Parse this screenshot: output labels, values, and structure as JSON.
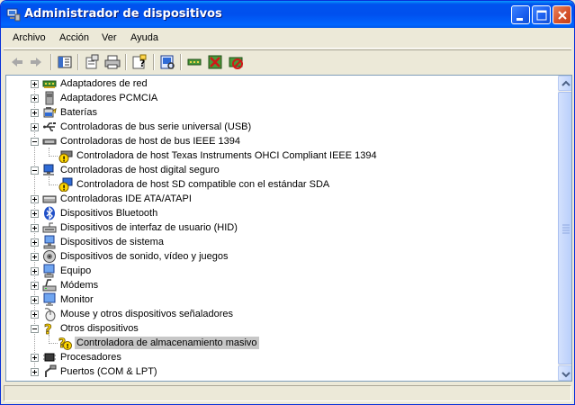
{
  "window": {
    "title": "Administrador de dispositivos",
    "app_icon": "device-manager-icon",
    "controls": [
      "minimize-icon",
      "maximize-icon",
      "close-icon"
    ]
  },
  "menu": {
    "items": [
      {
        "label": "Archivo"
      },
      {
        "label": "Acción"
      },
      {
        "label": "Ver"
      },
      {
        "label": "Ayuda"
      }
    ]
  },
  "toolbar": {
    "buttons": [
      {
        "icon": "back-arrow-icon"
      },
      {
        "icon": "forward-arrow-icon"
      },
      {
        "icon": "console-tree-icon"
      },
      {
        "icon": "properties-icon"
      },
      {
        "icon": "print-icon"
      },
      {
        "icon": "help-icon"
      },
      {
        "icon": "scan-hardware-icon"
      },
      {
        "icon": "update-driver-icon"
      },
      {
        "icon": "uninstall-icon"
      },
      {
        "icon": "disable-device-icon"
      }
    ]
  },
  "tree": {
    "items": [
      {
        "label": "Adaptadores de red",
        "icon": "network-adapter-icon",
        "level": 0,
        "expanded": false
      },
      {
        "label": "Adaptadores PCMCIA",
        "icon": "pcmcia-icon",
        "level": 0,
        "expanded": false
      },
      {
        "label": "Baterías",
        "icon": "battery-icon",
        "level": 0,
        "expanded": false
      },
      {
        "label": "Controladoras de bus serie universal (USB)",
        "icon": "usb-icon",
        "level": 0,
        "expanded": false
      },
      {
        "label": "Controladoras de host de bus IEEE 1394",
        "icon": "ieee1394-icon",
        "level": 0,
        "expanded": true
      },
      {
        "label": "Controladora de host Texas Instruments OHCI Compliant IEEE 1394",
        "icon": "warning-device-icon",
        "level": 1
      },
      {
        "label": "Controladoras de host digital seguro",
        "icon": "sd-host-icon",
        "level": 0,
        "expanded": true
      },
      {
        "label": "Controladora de host SD compatible con el estándar SDA",
        "icon": "warning-device-icon",
        "level": 1
      },
      {
        "label": "Controladoras IDE ATA/ATAPI",
        "icon": "ide-controller-icon",
        "level": 0,
        "expanded": false
      },
      {
        "label": "Dispositivos Bluetooth",
        "icon": "bluetooth-icon",
        "level": 0,
        "expanded": false
      },
      {
        "label": "Dispositivos de interfaz de usuario (HID)",
        "icon": "hid-icon",
        "level": 0,
        "expanded": false
      },
      {
        "label": "Dispositivos de sistema",
        "icon": "system-device-icon",
        "level": 0,
        "expanded": false
      },
      {
        "label": "Dispositivos de sonido, vídeo y juegos",
        "icon": "sound-icon",
        "level": 0,
        "expanded": false
      },
      {
        "label": "Equipo",
        "icon": "computer-icon",
        "level": 0,
        "expanded": false
      },
      {
        "label": "Módems",
        "icon": "modem-icon",
        "level": 0,
        "expanded": false
      },
      {
        "label": "Monitor",
        "icon": "monitor-icon",
        "level": 0,
        "expanded": false
      },
      {
        "label": "Mouse y otros dispositivos señaladores",
        "icon": "mouse-icon",
        "level": 0,
        "expanded": false
      },
      {
        "label": "Otros dispositivos",
        "icon": "unknown-device-icon",
        "level": 0,
        "expanded": true
      },
      {
        "label": "Controladora de almacenamiento masivo",
        "icon": "unknown-warning-icon",
        "level": 1,
        "selected": true
      },
      {
        "label": "Procesadores",
        "icon": "processor-icon",
        "level": 0,
        "expanded": false
      },
      {
        "label": "Puertos (COM & LPT)",
        "icon": "port-icon",
        "level": 0,
        "expanded": false
      }
    ]
  },
  "colors": {
    "titlebar": "#0053ee",
    "window_bg": "#ece9d8",
    "selection": "#c7c7c7"
  }
}
